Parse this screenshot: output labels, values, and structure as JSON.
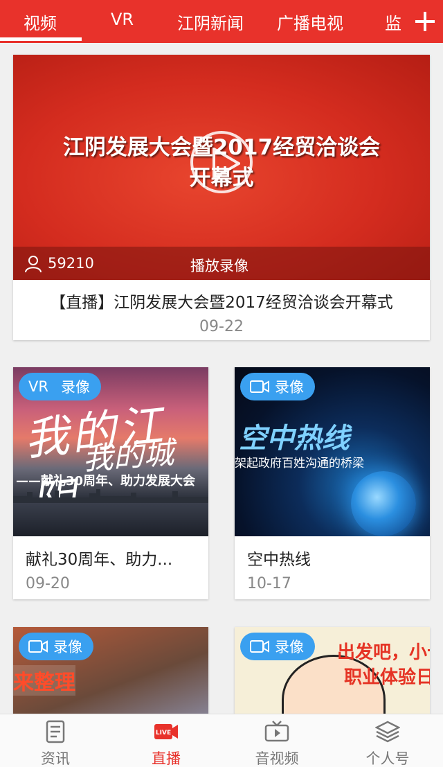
{
  "top_tabs": [
    "视频",
    "VR",
    "江阴新闻",
    "广播电视",
    "监"
  ],
  "active_tab": "视频",
  "featured": {
    "thumb_title_line1": "江阴发展大会暨2017经贸洽谈会",
    "thumb_title_line2": "开幕式",
    "viewer_count": "59210",
    "status_label": "播放录像",
    "caption": "【直播】江阴发展大会暨2017经贸洽谈会开幕式",
    "date": "09-22"
  },
  "cards": [
    {
      "badge_vr": "VR",
      "badge_label": "录像",
      "thumb_text_1": "我的江阴",
      "thumb_text_2": "我的城",
      "thumb_text_3": "——献礼30周年、助力发展大会",
      "title": "献礼30周年、助力...",
      "date": "09-20"
    },
    {
      "badge_label": "录像",
      "thumb_text_1": "空中热线",
      "thumb_text_2": "架起政府百姓沟通的桥梁",
      "title": "空中热线",
      "date": "10-17"
    },
    {
      "badge_label": "录像",
      "thumb_text_1": "来整理"
    },
    {
      "badge_label": "录像",
      "thumb_text_1": "出发吧，小十",
      "thumb_text_2": "职业体验日"
    }
  ],
  "bottom_nav": [
    {
      "label": "资讯",
      "icon": "news-icon"
    },
    {
      "label": "直播",
      "icon": "live-icon"
    },
    {
      "label": "音视频",
      "icon": "av-icon"
    },
    {
      "label": "个人号",
      "icon": "layers-icon"
    }
  ],
  "active_nav": "直播",
  "colors": {
    "brand_red": "#e8322b",
    "badge_blue": "#3aa0f0"
  }
}
